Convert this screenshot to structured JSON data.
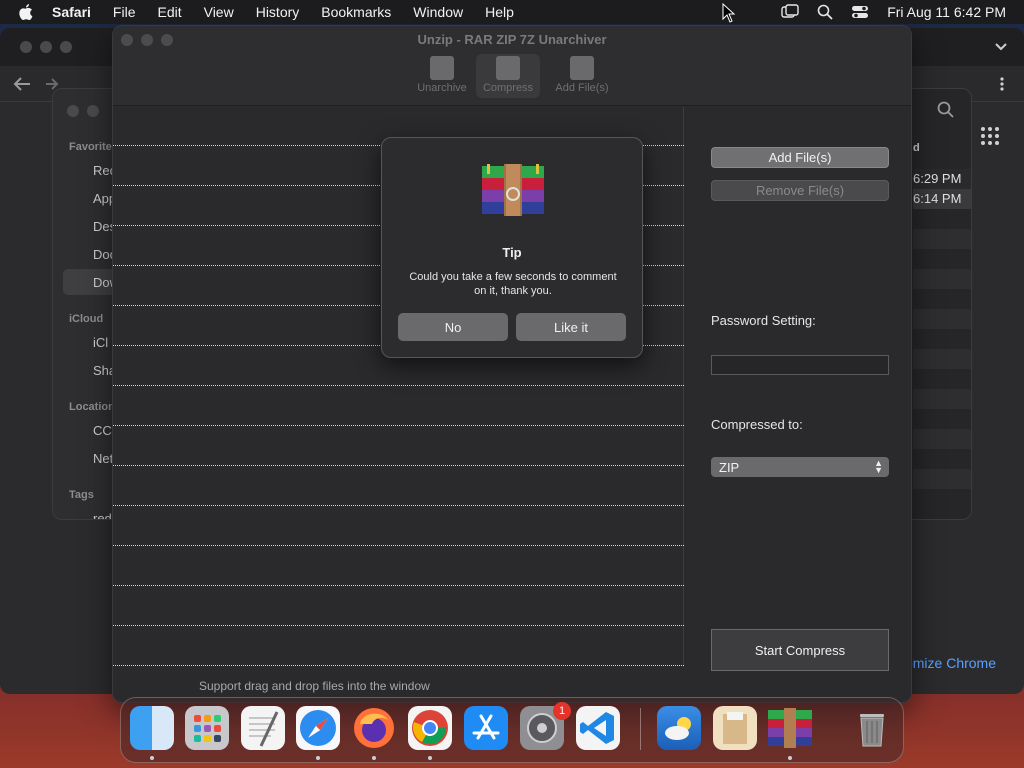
{
  "menubar": {
    "app_name": "Safari",
    "menus": [
      "File",
      "Edit",
      "View",
      "History",
      "Bookmarks",
      "Window",
      "Help"
    ],
    "datetime": "Fri Aug 11  6:42 PM"
  },
  "finder": {
    "sidebar": {
      "favorites_header": "Favorite",
      "items": [
        "Rec",
        "App",
        "Des",
        "Doc",
        "Dow"
      ],
      "icloud_header": "iCloud",
      "icloud_items": [
        "iCl",
        "Sha"
      ],
      "locations_header": "Location",
      "location_items": [
        "CC",
        "Net"
      ],
      "tags_header": "Tags",
      "tag_items": [
        "red"
      ]
    },
    "column_header": "d",
    "times": [
      "6:29 PM",
      "6:14 PM"
    ]
  },
  "safari": {
    "customize_text": "omize Chrome"
  },
  "unzip": {
    "title": "Unzip - RAR ZIP 7Z Unarchiver",
    "toolbar": [
      {
        "label": "Unarchive",
        "icon": "unarchive-icon"
      },
      {
        "label": "Compress",
        "icon": "compress-icon"
      },
      {
        "label": "Add File(s)",
        "icon": "add-file-icon"
      }
    ],
    "hint": "Support drag and drop files into the window",
    "add_files": "Add File(s)",
    "remove_files": "Remove File(s)",
    "password_label": "Password Setting:",
    "password_value": "",
    "compressed_to_label": "Compressed to:",
    "format": "ZIP",
    "start": "Start Compress"
  },
  "dialog": {
    "title": "Tip",
    "message": "Could you take a few seconds to comment on it, thank you.",
    "no": "No",
    "like": "Like it"
  },
  "dock": {
    "apps": [
      "Finder",
      "Launchpad",
      "TextEdit",
      "Safari",
      "Firefox",
      "Chrome",
      "App Store",
      "System Settings",
      "VS Code",
      "Weather",
      "Archive Utility",
      "Unzip",
      "Trash"
    ],
    "settings_badge": "1"
  },
  "colors": {
    "accent": "#5aa0ff",
    "badge": "#e5332a"
  }
}
